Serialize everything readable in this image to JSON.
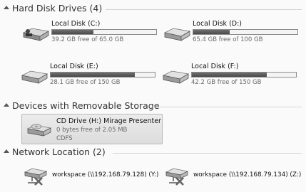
{
  "groups": {
    "hard_disks": {
      "title": "Hard Disk Drives (4)"
    },
    "removable": {
      "title": "Devices with Removable Storage"
    },
    "network": {
      "title": "Network Location (2)"
    }
  },
  "drives": [
    {
      "name": "Local Disk (C:)",
      "free_text": "39.2 GB free of 65.0 GB",
      "used_fraction": 0.4
    },
    {
      "name": "Local Disk (D:)",
      "free_text": "65.4 GB free of 100 GB",
      "used_fraction": 0.35
    },
    {
      "name": "Local Disk (E:)",
      "free_text": "28.1 GB free of 150 GB",
      "used_fraction": 0.81
    },
    {
      "name": "Local Disk (F:)",
      "free_text": "42.2 GB free of 150 GB",
      "used_fraction": 0.72
    }
  ],
  "removable": {
    "name": "CD Drive (H:) Mirage Presenter",
    "free_text": "0 bytes free of 2.05 MB",
    "filesystem": "CDFS"
  },
  "network": [
    {
      "label": "workspace (\\\\192.168.79.128) (Y:)"
    },
    {
      "label": "workspace (\\\\192.168.79.134) (Z:)"
    }
  ],
  "colors": {
    "bar_fill": "#555555",
    "selection_bg": "#e3e3e3",
    "group_line": "#d4d4d4"
  },
  "icons": {
    "hard_disk": "hard-drive-icon",
    "cd": "cd-drive-icon",
    "network_drive": "network-drive-icon",
    "collapse": "collapse-chevron-icon"
  }
}
